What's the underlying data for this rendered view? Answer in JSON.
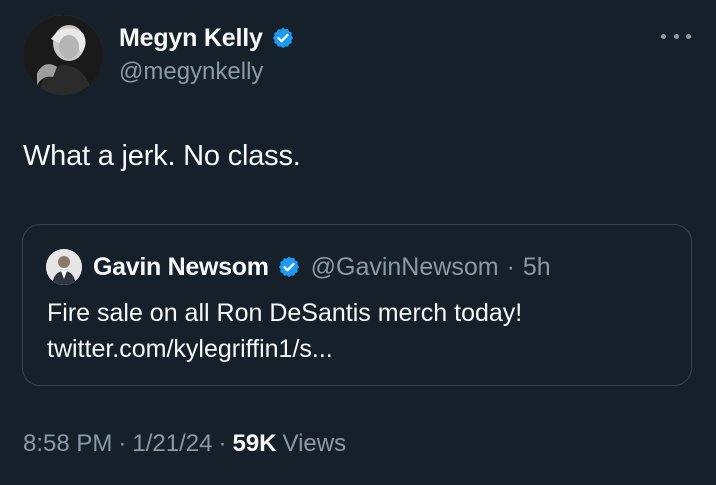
{
  "author": {
    "display_name": "Megyn Kelly",
    "handle": "@megynkelly",
    "verified": true
  },
  "tweet": {
    "text": "What a jerk. No class."
  },
  "quoted_tweet": {
    "display_name": "Gavin Newsom",
    "handle": "@GavinNewsom",
    "separator": "·",
    "time": "5h",
    "verified": true,
    "text_line1": "Fire sale on all Ron DeSantis merch today!",
    "text_line2": "twitter.com/kylegriffin1/s..."
  },
  "meta": {
    "time": "8:58 PM",
    "sep1": "·",
    "date": "1/21/24",
    "sep2": "·",
    "views_count": "59K",
    "views_label": "Views"
  },
  "colors": {
    "background": "#15202b",
    "primary_text": "#f7f9f9",
    "secondary_text": "#8b98a5",
    "verified_blue": "#1d9bf0",
    "border": "#38444d"
  },
  "icons": {
    "more": "more-horizontal-icon",
    "verified": "verified-badge-icon"
  }
}
